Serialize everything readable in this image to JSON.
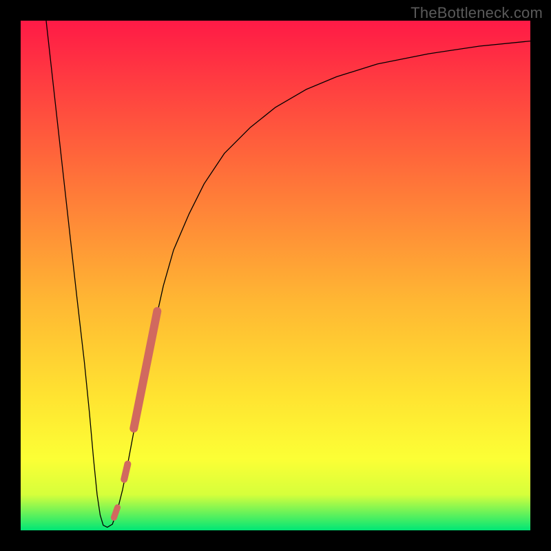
{
  "watermark": "TheBottleneck.com",
  "chart_data": {
    "type": "line",
    "title": "",
    "xlabel": "",
    "ylabel": "",
    "xlim": [
      0,
      100
    ],
    "ylim": [
      0,
      100
    ],
    "background_gradient": {
      "top": "#ff1a46",
      "mid1": "#ff6a3a",
      "mid2": "#ffb733",
      "mid3": "#ffe431",
      "mid4": "#fcff35",
      "bottom_band_top": "#d6ff3b",
      "bottom": "#00e676"
    },
    "series": [
      {
        "name": "bottleneck-curve",
        "color": "#000000",
        "stroke_width": 1.3,
        "x": [
          5,
          7,
          9,
          11,
          12.5,
          13.5,
          14.3,
          15,
          15.6,
          16.2,
          17,
          18,
          19,
          20,
          21,
          22.5,
          24,
          26,
          28,
          30,
          33,
          36,
          40,
          45,
          50,
          56,
          62,
          70,
          80,
          90,
          100
        ],
        "y": [
          100,
          82,
          64,
          46,
          33,
          23,
          14,
          7,
          3,
          1,
          0.6,
          1.2,
          4,
          8,
          13,
          21,
          29,
          39,
          48,
          55,
          62,
          68,
          74,
          79,
          83,
          86.5,
          89,
          91.5,
          93.5,
          95,
          96
        ]
      },
      {
        "name": "highlight-segment-upper",
        "color": "#d1695f",
        "stroke_width": 12,
        "linecap": "round",
        "x": [
          22.2,
          26.8
        ],
        "y": [
          20,
          43
        ]
      },
      {
        "name": "highlight-dot-mid",
        "color": "#d1695f",
        "stroke_width": 10,
        "linecap": "round",
        "x": [
          20.3,
          21.0
        ],
        "y": [
          10,
          13
        ]
      },
      {
        "name": "highlight-dot-low",
        "color": "#d1695f",
        "stroke_width": 9,
        "linecap": "round",
        "x": [
          18.3,
          19.0
        ],
        "y": [
          2.5,
          4.5
        ]
      }
    ]
  }
}
